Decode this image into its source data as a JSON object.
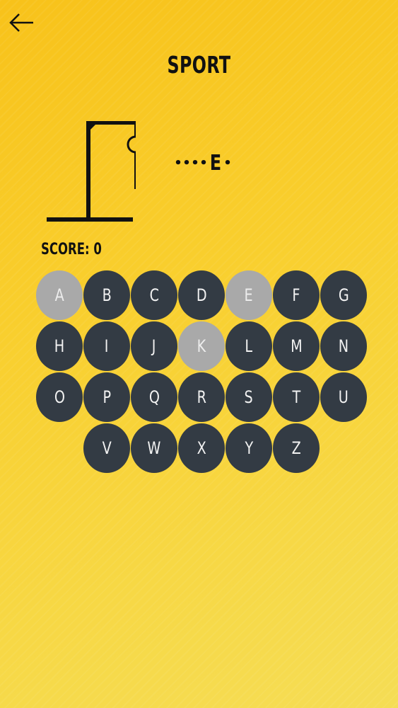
{
  "header": {
    "title": "SPORT",
    "back_icon": "arrow-left-icon"
  },
  "word": {
    "slots": [
      "•",
      "•",
      "•",
      "•",
      "E",
      "•"
    ]
  },
  "score": {
    "label": "SCORE: 0"
  },
  "keyboard": {
    "keys": [
      {
        "letter": "A",
        "used": true
      },
      {
        "letter": "B",
        "used": false
      },
      {
        "letter": "C",
        "used": false
      },
      {
        "letter": "D",
        "used": false
      },
      {
        "letter": "E",
        "used": true
      },
      {
        "letter": "F",
        "used": false
      },
      {
        "letter": "G",
        "used": false
      },
      {
        "letter": "H",
        "used": false
      },
      {
        "letter": "I",
        "used": false
      },
      {
        "letter": "J",
        "used": false
      },
      {
        "letter": "K",
        "used": true
      },
      {
        "letter": "L",
        "used": false
      },
      {
        "letter": "M",
        "used": false
      },
      {
        "letter": "N",
        "used": false
      },
      {
        "letter": "O",
        "used": false
      },
      {
        "letter": "P",
        "used": false
      },
      {
        "letter": "Q",
        "used": false
      },
      {
        "letter": "R",
        "used": false
      },
      {
        "letter": "S",
        "used": false
      },
      {
        "letter": "T",
        "used": false
      },
      {
        "letter": "U",
        "used": false
      },
      {
        "letter": "V",
        "used": false
      },
      {
        "letter": "W",
        "used": false
      },
      {
        "letter": "X",
        "used": false
      },
      {
        "letter": "Y",
        "used": false
      },
      {
        "letter": "Z",
        "used": false
      }
    ]
  },
  "colors": {
    "key_active": "#333b44",
    "key_used": "#a9a9a9",
    "background": "#f9cf2e"
  }
}
